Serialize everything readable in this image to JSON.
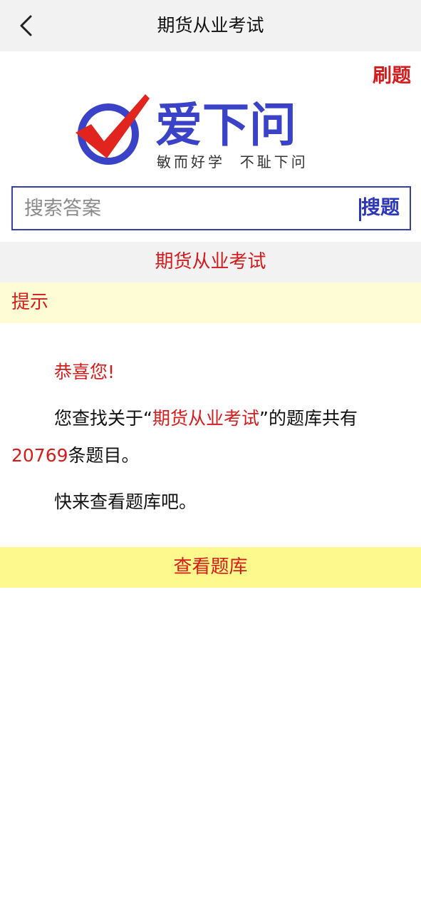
{
  "nav": {
    "title": "期货从业考试",
    "back_icon": "chevron-left-icon"
  },
  "header": {
    "shuati_label": "刷题"
  },
  "logo": {
    "brand": "爱下问",
    "slogan": "敏而好学  不耻下问",
    "icon": "red-check-mark-circle-icon",
    "brand_color": "#3a43c8",
    "check_color": "#e2241f"
  },
  "search": {
    "placeholder": "搜索答案",
    "value": "",
    "button_label": "搜题"
  },
  "section": {
    "title": "期货从业考试"
  },
  "tip": {
    "label": "提示"
  },
  "message": {
    "greeting": "恭喜您!",
    "line_pre": "您查找关于",
    "quote_open": "“",
    "keyword": "期货从业考试",
    "quote_close": "”",
    "line_mid": "的题库共有",
    "count": "20769",
    "line_post": "条题目。",
    "prompt": "快来查看题库吧。"
  },
  "action": {
    "view_label": "查看题库"
  },
  "colors": {
    "accent_red": "#d51b1b",
    "accent_blue": "#2c37b8",
    "tip_bg": "#fefcd4",
    "button_bg": "#fdf98c"
  }
}
